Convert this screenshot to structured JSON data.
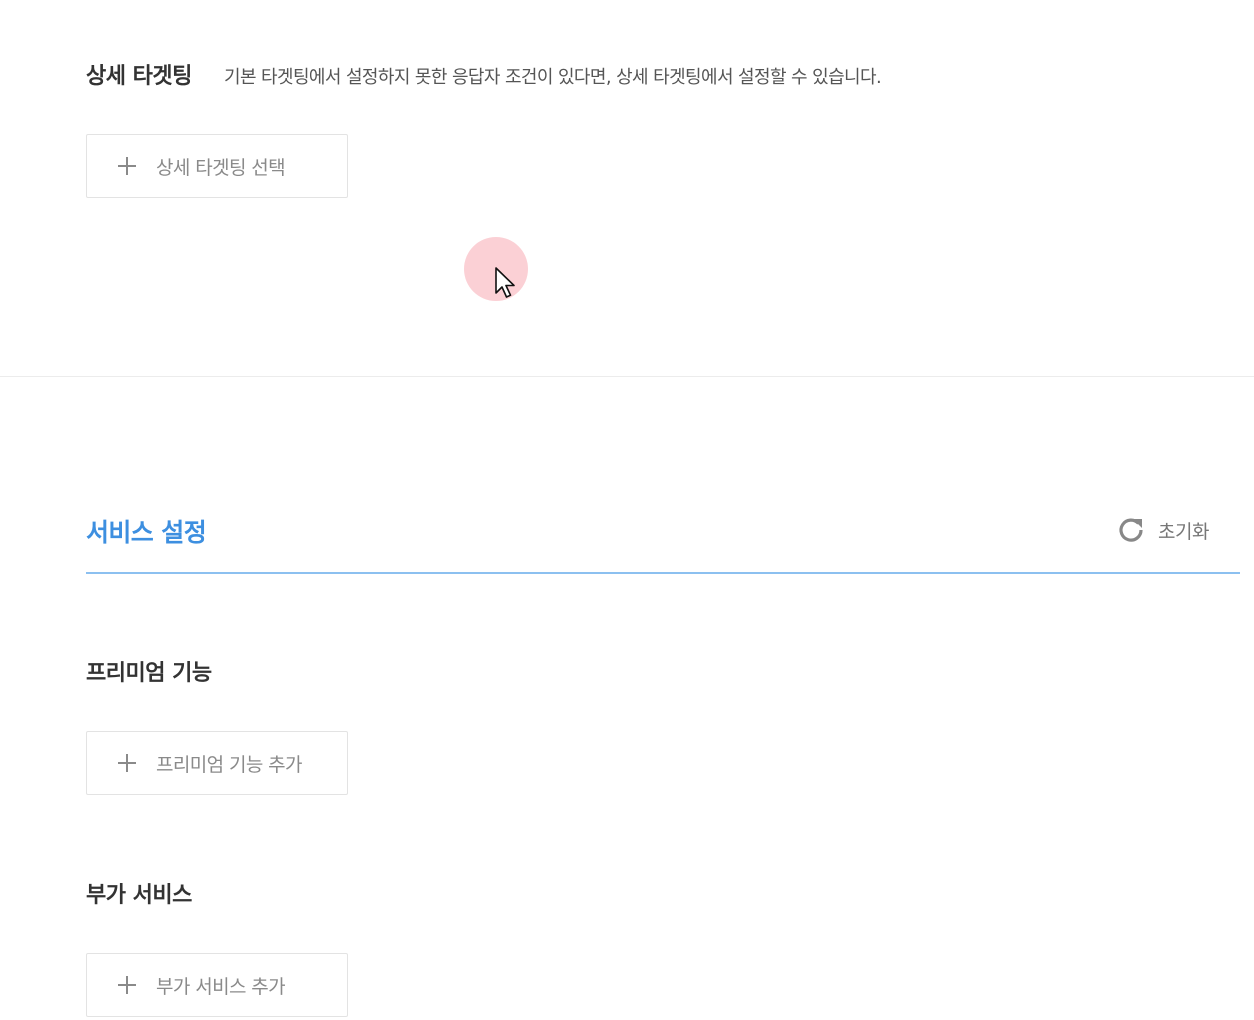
{
  "detailed_targeting": {
    "title": "상세 타겟팅",
    "description": "기본 타겟팅에서 설정하지 못한 응답자 조건이 있다면, 상세 타겟팅에서 설정할 수 있습니다.",
    "select_button_label": "상세 타겟팅 선택"
  },
  "service_settings": {
    "title": "서비스 설정",
    "reset_label": "초기화",
    "accent_color": "#3d8fe0",
    "premium": {
      "title": "프리미엄 기능",
      "add_button_label": "프리미엄 기능 추가"
    },
    "additional": {
      "title": "부가 서비스",
      "add_button_label": "부가 서비스 추가"
    }
  },
  "icons": {
    "plus": "plus-icon",
    "reset": "refresh-icon",
    "cursor": "mouse-pointer-icon"
  }
}
